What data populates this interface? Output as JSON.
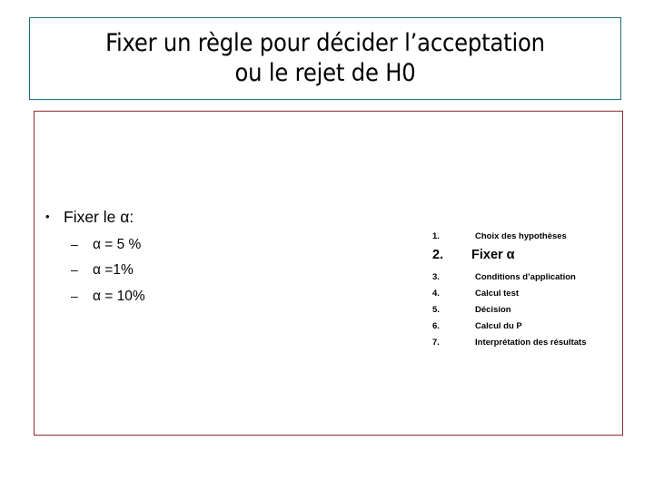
{
  "slide": {
    "title": {
      "line1": "Fixer un règle pour décider l’acceptation",
      "line2": "ou le rejet de H0"
    },
    "colors": {
      "title_border": "#1F6E7D",
      "content_border": "#8B2B2B",
      "background": "#FFFFFF",
      "text": "#000000"
    },
    "left_content": {
      "bullet_marker": "•",
      "bullet_label": "Fixer le α:",
      "sub_marker": "–",
      "sub_items": [
        {
          "label": "α = 5 %"
        },
        {
          "label": "α =1%"
        },
        {
          "label": "α = 10%"
        }
      ]
    },
    "right_content": {
      "steps": [
        {
          "num": "1.",
          "label": "Choix des hypothèses",
          "emphasis": false
        },
        {
          "num": "2.",
          "label": "Fixer α",
          "emphasis": true
        },
        {
          "num": "3.",
          "label": "Conditions d’application",
          "emphasis": false
        },
        {
          "num": "4.",
          "label": "Calcul test",
          "emphasis": false
        },
        {
          "num": "5.",
          "label": "Décision",
          "emphasis": false
        },
        {
          "num": "6.",
          "label": "Calcul du P",
          "emphasis": false
        },
        {
          "num": "7.",
          "label": "Interprétation des résultats",
          "emphasis": false
        }
      ]
    }
  }
}
